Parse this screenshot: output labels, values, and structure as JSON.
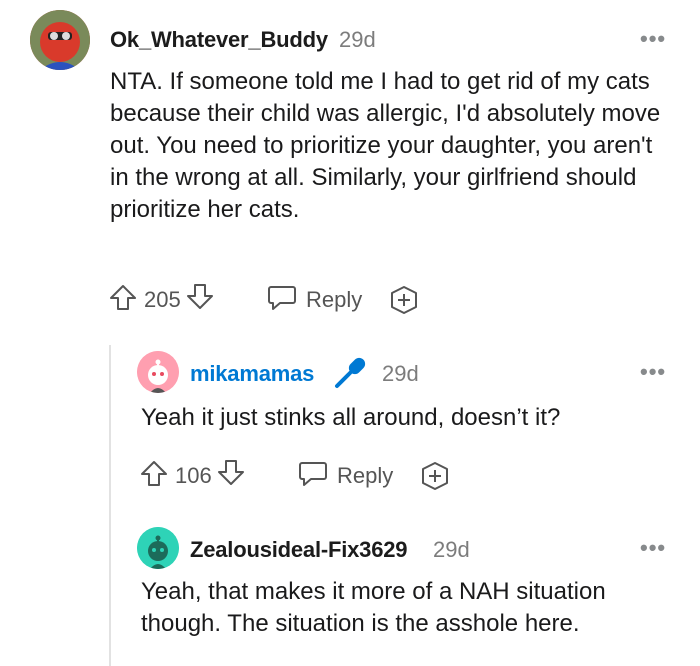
{
  "comments": [
    {
      "username": "Ok_Whatever_Buddy",
      "age": "29d",
      "text": "NTA. If someone told me I had to get rid of my cats because their child was allergic, I'd absolutely move out. You need to prioritize your daughter, you aren't in the wrong at all. Similarly, your girlfriend should prioritize her cats.",
      "score": "205",
      "reply_label": "Reply",
      "more": "•••"
    },
    {
      "username": "mikamamas",
      "age": "29d",
      "text": "Yeah it just stinks all around, doesn’t it?",
      "score": "106",
      "reply_label": "Reply",
      "more": "•••"
    },
    {
      "username": "Zealousideal-Fix3629",
      "age": "29d",
      "text": "Yeah, that makes it more of a NAH situation though. The situation is the asshole here.",
      "more": "•••"
    }
  ],
  "colors": {
    "mod_accent": "#0079d3",
    "avatar1_bg": "#d93a2b",
    "avatar2_bg": "#ff9fb0",
    "avatar3_bg": "#2ed3b7"
  },
  "icons": [
    "upvote-icon",
    "downvote-icon",
    "reply-icon",
    "award-icon",
    "mic-icon",
    "more-icon"
  ]
}
